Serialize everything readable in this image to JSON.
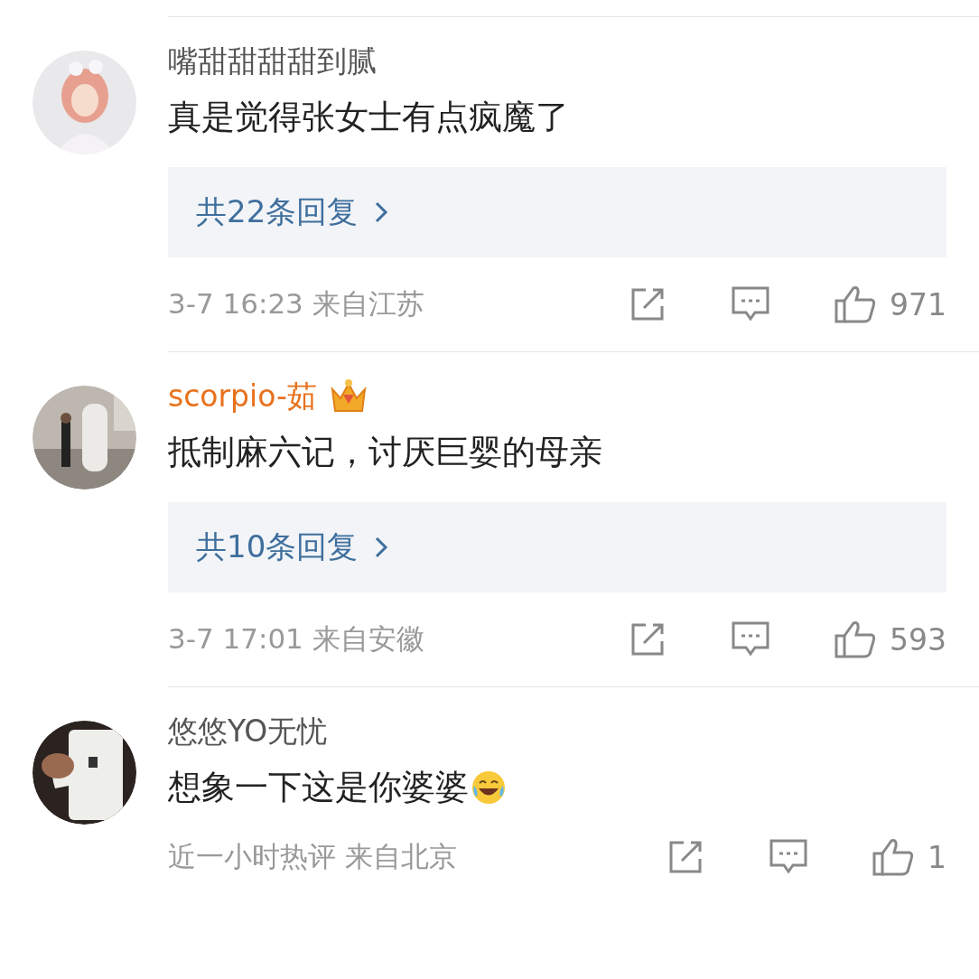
{
  "comments": [
    {
      "name": "嘴甜甜甜甜到腻",
      "vip": false,
      "text": "真是觉得张女士有点疯魔了",
      "has_emoji": false,
      "replies": "共22条回复",
      "time": "3-7 16:23",
      "location": "来自江苏",
      "likes": "971"
    },
    {
      "name": "scorpio-茹",
      "vip": true,
      "text": "抵制麻六记，讨厌巨婴的母亲",
      "has_emoji": false,
      "replies": "共10条回复",
      "time": "3-7 17:01",
      "location": "来自安徽",
      "likes": "593"
    },
    {
      "name": "悠悠YO无忧",
      "vip": false,
      "text": "想象一下这是你婆婆",
      "has_emoji": true,
      "time": "近一小时热评",
      "location": "来自北京",
      "likes": "1"
    }
  ]
}
